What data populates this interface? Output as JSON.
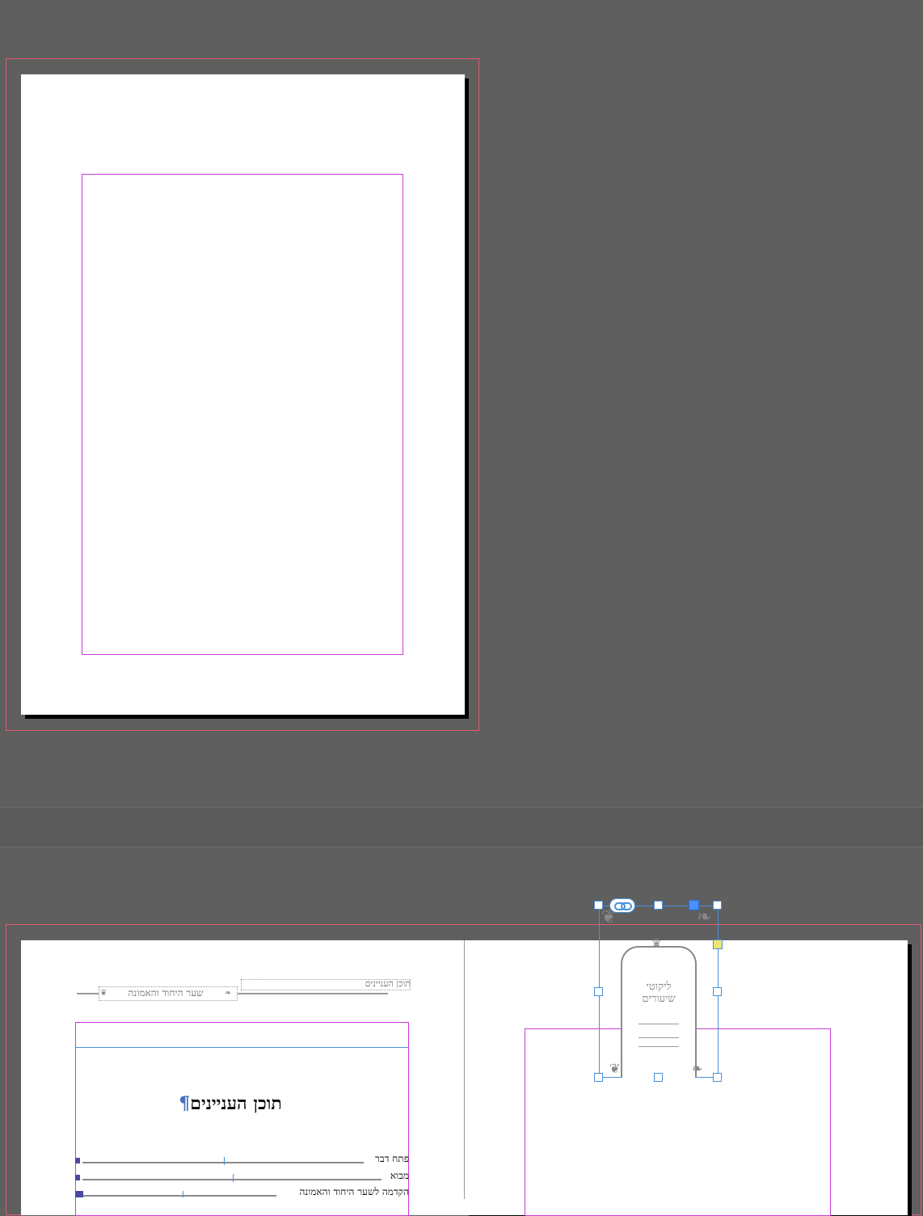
{
  "colors": {
    "pasteboard": "#5f5f5f",
    "bleed_guide": "#e05a6c",
    "margin_guide": "#c83ad6",
    "selection": "#4a90d9",
    "page": "#ffffff"
  },
  "spread2": {
    "left_page": {
      "running_header_right": "תוכן העניינים",
      "running_header_section": "שער היחוד והאמונה",
      "toc_title": "תוכן העניינים",
      "pilcrow": "¶",
      "toc_entries": [
        {
          "label": "פתח דבר"
        },
        {
          "label": "מבוא"
        },
        {
          "label": "הקדמה לשער היחוד והאמונה"
        }
      ]
    },
    "right_page": {
      "cover_title_line1": "ליקוטי",
      "cover_title_line2": "שיעורים",
      "selected_frame": {
        "link_icon": "link-icon"
      }
    }
  }
}
